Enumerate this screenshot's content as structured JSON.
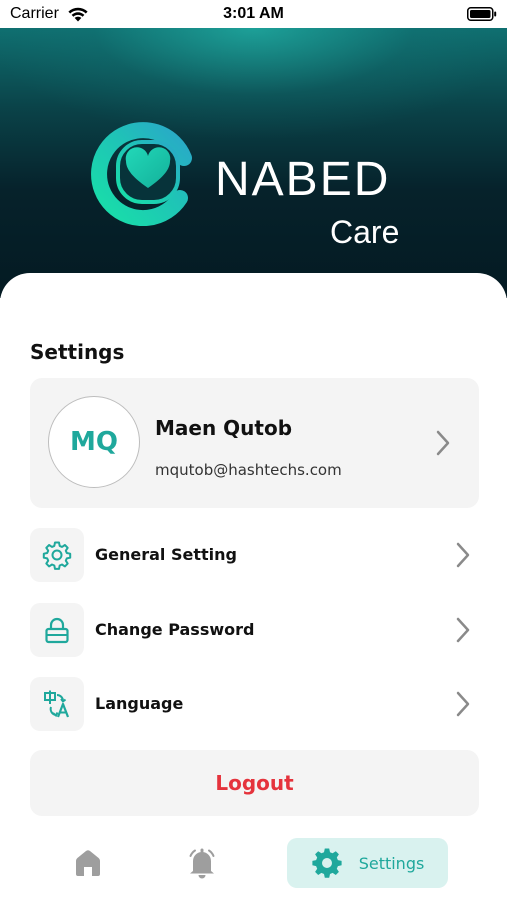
{
  "status_bar": {
    "carrier": "Carrier",
    "time": "3:01 AM"
  },
  "header": {
    "brand_name": "NABED",
    "brand_sub": "Care"
  },
  "settings": {
    "title": "Settings",
    "profile": {
      "initials": "MQ",
      "name": "Maen Qutob",
      "email": "mqutob@hashtechs.com"
    },
    "menu": [
      {
        "label": "General Setting",
        "icon": "gear-icon"
      },
      {
        "label": "Change Password",
        "icon": "lock-icon"
      },
      {
        "label": "Language",
        "icon": "translate-icon"
      }
    ],
    "logout_label": "Logout"
  },
  "bottom_nav": {
    "items": [
      {
        "icon": "home-icon",
        "active": false
      },
      {
        "icon": "bell-icon",
        "active": false
      },
      {
        "icon": "gear-icon",
        "label": "Settings",
        "active": true
      }
    ]
  },
  "colors": {
    "accent": "#1fa89c",
    "logout": "#e5333c",
    "card_bg": "#f4f4f4",
    "active_tab_bg": "#d9f2ef",
    "inactive_icon": "#9e9e9e"
  }
}
